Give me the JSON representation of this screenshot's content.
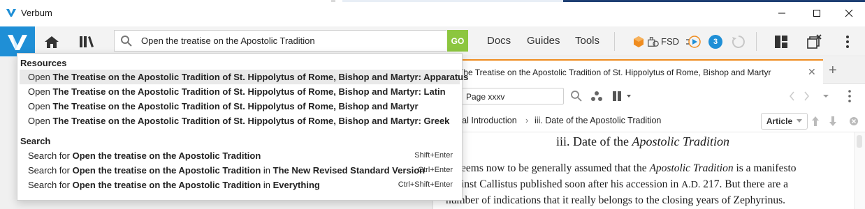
{
  "window": {
    "title": "Verbum",
    "minimize_icon": "minimize-icon",
    "maximize_icon": "maximize-icon",
    "close_icon": "close-icon"
  },
  "toolbar": {
    "home_icon": "home-icon",
    "library_icon": "library-icon",
    "search_value": "Open the treatise on the Apostolic Tradition",
    "go_label": "GO",
    "nav": [
      "Docs",
      "Guides",
      "Tools"
    ],
    "fsd_label": "FSD",
    "notifications_count": "3",
    "colors": {
      "brand": "#1f8fd6",
      "go": "#8cc63f",
      "tab_accent": "#ef8c1f"
    }
  },
  "dropdown": {
    "resources_heading": "Resources",
    "open_prefix": "Open",
    "resources": [
      "The Treatise on the Apostolic Tradition of St. Hippolytus of Rome, Bishop and Martyr: Apparatus",
      "The Treatise on the Apostolic Tradition of St. Hippolytus of Rome, Bishop and Martyr: Latin",
      "The Treatise on the Apostolic Tradition of St. Hippolytus of Rome, Bishop and Martyr",
      "The Treatise on the Apostolic Tradition of St. Hippolytus of Rome, Bishop and Martyr: Greek"
    ],
    "search_heading": "Search",
    "search_prefix": "Search for",
    "search_query": "Open the treatise on the Apostolic Tradition",
    "in_word": "in",
    "searches": [
      {
        "scope": "",
        "shortcut": "Shift+Enter"
      },
      {
        "scope": "The New Revised Standard Version",
        "shortcut": "Ctrl+Enter"
      },
      {
        "scope": "Everything",
        "shortcut": "Ctrl+Shift+Enter"
      }
    ]
  },
  "document": {
    "tab_title": "The Treatise on the Apostolic Tradition of St. Hippolytus of Rome, Bishop and Martyr",
    "page_field": "Page xxxv",
    "breadcrumb_first": "ral Introduction",
    "breadcrumb_sep": "›",
    "breadcrumb_current": "iii. Date of the Apostolic Tradition",
    "article_label": "Article",
    "heading_plain": "iii. Date of the ",
    "heading_italic": "Apostolic Tradition",
    "line1_a": "eems now to be generally assumed that the ",
    "line1_i": "Apostolic Tradition",
    "line1_b": " is a manifesto",
    "line2_a": "inst Callistus published soon after his accession in ",
    "line2_sc": "A.D.",
    "line2_b": " 217. But there are a",
    "line3": "number of indications that it really belongs to the closing years of Zephyrinus."
  }
}
